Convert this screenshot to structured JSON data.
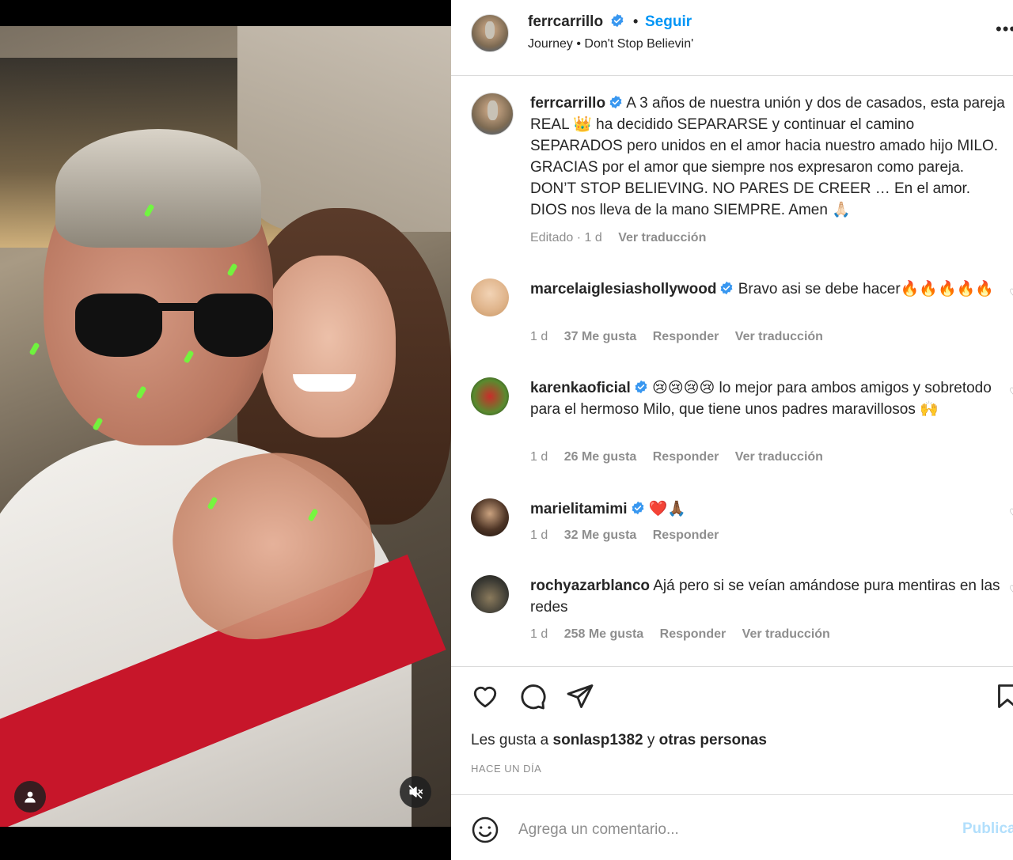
{
  "post": {
    "username": "ferrcarrillo",
    "follow_label": "Seguir",
    "audio": "Journey • Don't Stop Believin'",
    "more_label": "•••"
  },
  "caption": {
    "username": "ferrcarrillo",
    "text": " A 3 años de nuestra unión y dos de casados, esta pareja REAL 👑 ha decidido SEPARARSE y continuar el camino SEPARADOS pero unidos en el amor hacia nuestro amado hijo MILO. GRACIAS por el amor que siempre nos expresaron como pareja. DON’T STOP BELIEVING. NO PARES DE CREER … En el amor. DIOS nos lleva de la mano SIEMPRE. Amen 🙏🏻",
    "edited": "Editado · 1 d",
    "translate": "Ver traducción"
  },
  "comments": [
    {
      "username": "marcelaiglesiashollywood",
      "verified": true,
      "text": " Bravo asi se debe hacer🔥🔥🔥🔥🔥",
      "age": "1 d",
      "likes": "37 Me gusta",
      "reply": "Responder",
      "translate": "Ver traducción"
    },
    {
      "username": "karenkaoficial",
      "verified": true,
      "text": " 😢😢😢😢 lo mejor para ambos amigos y sobretodo para el hermoso Milo, que tiene unos padres maravillosos 🙌",
      "age": "1 d",
      "likes": "26 Me gusta",
      "reply": "Responder",
      "translate": "Ver traducción"
    },
    {
      "username": "marielitamimi",
      "verified": true,
      "text": " ❤️🙏🏾",
      "age": "1 d",
      "likes": "32 Me gusta",
      "reply": "Responder"
    },
    {
      "username": "rochyazarblanco",
      "verified": false,
      "text": " Ajá pero si se veían amándose pura mentiras en las redes",
      "age": "1 d",
      "likes": "258 Me gusta",
      "reply": "Responder",
      "translate": "Ver traducción"
    }
  ],
  "likes_line": {
    "prefix": "Les gusta a ",
    "user": "sonIasp1382",
    "middle": " y ",
    "others": "otras personas"
  },
  "timestamp": "HACE UN DÍA",
  "composer": {
    "placeholder": "Agrega un comentario...",
    "publish": "Publicar"
  },
  "icons": {
    "verified": "verified-badge-icon",
    "like": "heart-icon",
    "comment": "comment-bubble-icon",
    "share": "paper-plane-icon",
    "save": "bookmark-icon",
    "emoji": "emoji-smile-icon",
    "user": "person-icon",
    "mute": "speaker-muted-icon"
  },
  "colors": {
    "link_blue": "#0095f6",
    "verified_blue": "#3897f0",
    "muted_text": "#8e8e8e",
    "publish_disabled": "#b2dffc"
  }
}
